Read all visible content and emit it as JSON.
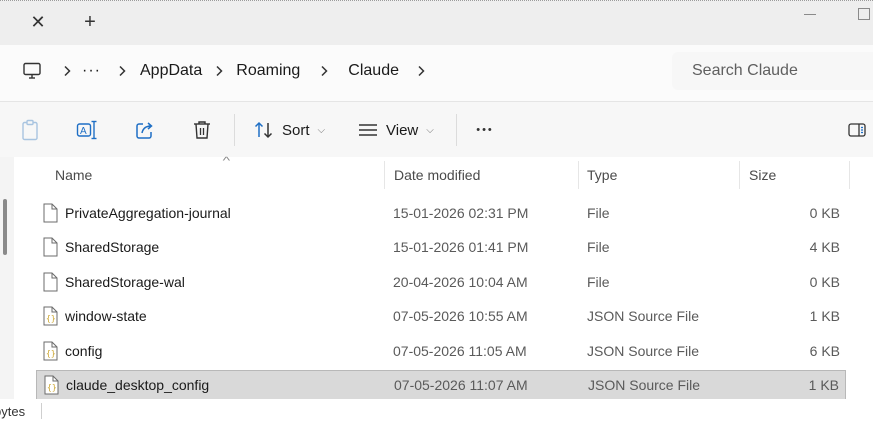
{
  "tabs": {
    "close_glyph": "✕",
    "new_glyph": "+"
  },
  "address": {
    "ellipsis": "···",
    "crumbs": [
      "AppData",
      "Roaming",
      "Claude"
    ],
    "search_placeholder": "Search Claude"
  },
  "toolbar": {
    "sort_label": "Sort",
    "view_label": "View",
    "more_label": "•••",
    "icons": [
      "paste-icon",
      "rename-icon",
      "share-icon",
      "delete-icon",
      "sort-icon",
      "view-icon",
      "details-pane-icon"
    ]
  },
  "columns": {
    "name": "Name",
    "date": "Date modified",
    "type": "Type",
    "size": "Size"
  },
  "files": [
    {
      "name": "PrivateAggregation-journal",
      "date": "15-01-2026 02:31 PM",
      "type": "File",
      "size": "0 KB",
      "icon": "file-icon"
    },
    {
      "name": "SharedStorage",
      "date": "15-01-2026 01:41 PM",
      "type": "File",
      "size": "4 KB",
      "icon": "file-icon"
    },
    {
      "name": "SharedStorage-wal",
      "date": "20-04-2026 10:04 AM",
      "type": "File",
      "size": "0 KB",
      "icon": "file-icon"
    },
    {
      "name": "window-state",
      "date": "07-05-2026 10:55 AM",
      "type": "JSON Source File",
      "size": "1 KB",
      "icon": "json-file-icon"
    },
    {
      "name": "config",
      "date": "07-05-2026 11:05 AM",
      "type": "JSON Source File",
      "size": "6 KB",
      "icon": "json-file-icon"
    },
    {
      "name": "claude_desktop_config",
      "date": "07-05-2026 11:07 AM",
      "type": "JSON Source File",
      "size": "1 KB",
      "icon": "json-file-icon",
      "selected": true
    }
  ],
  "status": {
    "text": "bytes"
  },
  "colors": {
    "selected_row": "#d9d9d9",
    "json_icon": "#c9a227"
  }
}
